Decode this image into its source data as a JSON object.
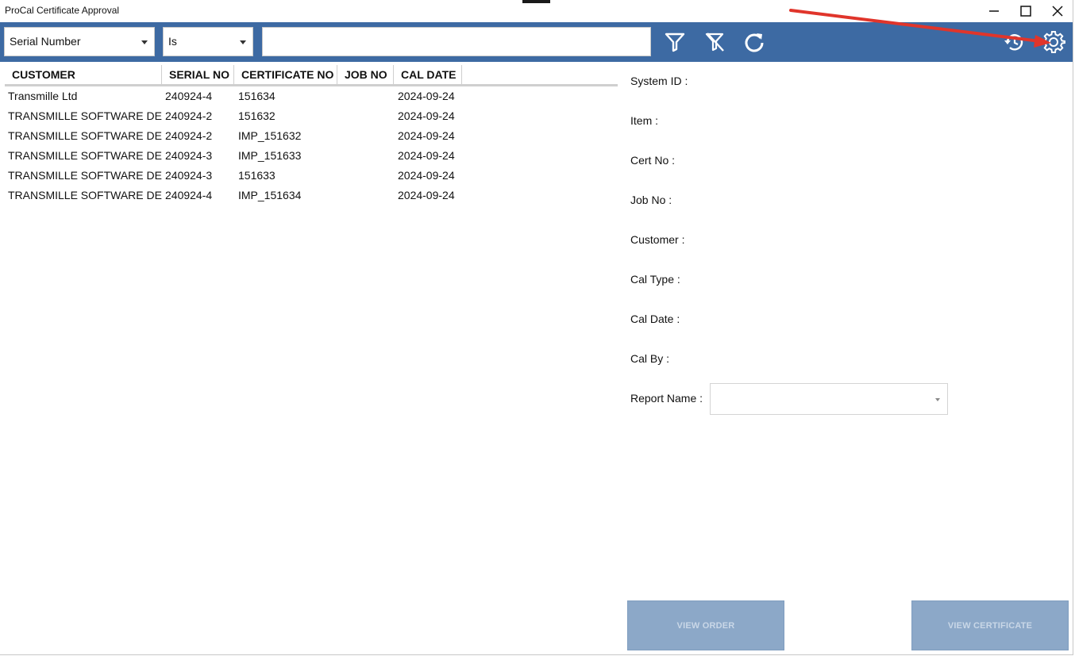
{
  "window": {
    "title": "ProCal Certificate Approval"
  },
  "toolbar": {
    "field_select": "Serial Number",
    "operator_select": "Is",
    "search_value": "",
    "icons": [
      "filter-icon",
      "clear-filter-icon",
      "refresh-icon",
      "history-icon",
      "gear-icon"
    ],
    "accent_color": "#3d6aa3"
  },
  "table": {
    "columns": [
      "CUSTOMER",
      "SERIAL NO",
      "CERTIFICATE NO",
      "JOB NO",
      "CAL DATE"
    ],
    "rows": [
      [
        "Transmille Ltd",
        "240924-4",
        "151634",
        "",
        "2024-09-24"
      ],
      [
        "TRANSMILLE SOFTWARE DEV",
        "240924-2",
        "151632",
        "",
        "2024-09-24"
      ],
      [
        "TRANSMILLE SOFTWARE DEV",
        "240924-2",
        "IMP_151632",
        "",
        "2024-09-24"
      ],
      [
        "TRANSMILLE SOFTWARE DEV",
        "240924-3",
        "IMP_151633",
        "",
        "2024-09-24"
      ],
      [
        "TRANSMILLE SOFTWARE DEV",
        "240924-3",
        "151633",
        "",
        "2024-09-24"
      ],
      [
        "TRANSMILLE SOFTWARE DEV",
        "240924-4",
        "IMP_151634",
        "",
        "2024-09-24"
      ]
    ]
  },
  "details": {
    "labels": [
      "System ID :",
      "Item :",
      "Cert No :",
      "Job No :",
      "Customer :",
      "Cal Type :",
      "Cal Date :",
      "Cal By :",
      "Report Name :"
    ],
    "report_name_value": ""
  },
  "buttons": {
    "view_order": "VIEW ORDER",
    "view_certificate": "VIEW CERTIFICATE"
  }
}
